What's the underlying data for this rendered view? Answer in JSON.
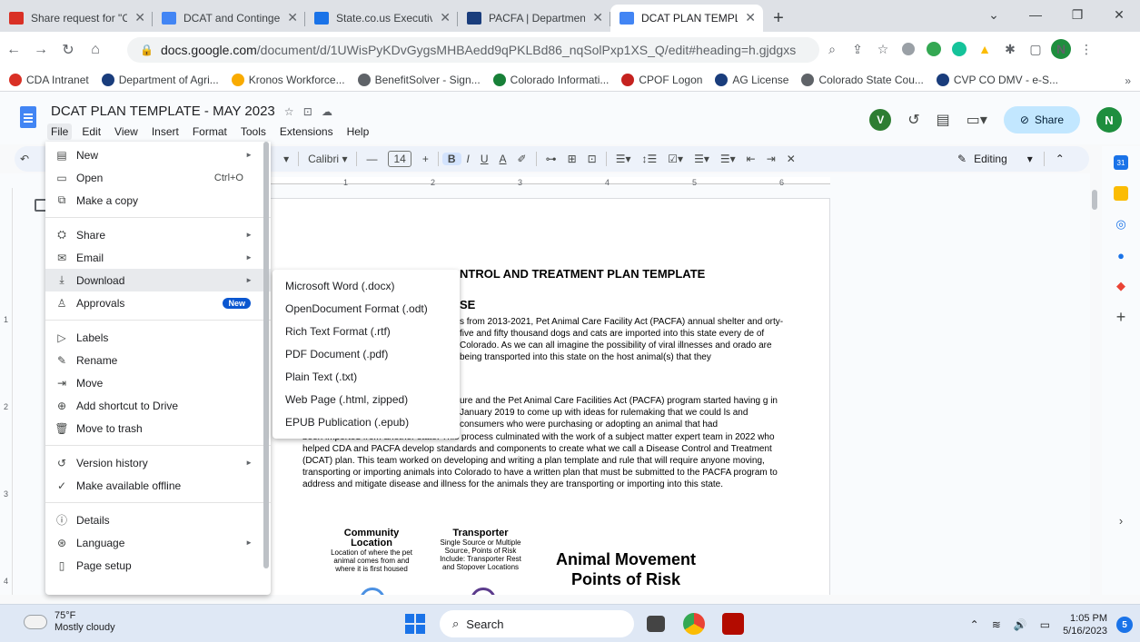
{
  "browser": {
    "tabs": [
      {
        "label": "Share request for \"CONTI",
        "fav_color": "#d93025",
        "active": false
      },
      {
        "label": "DCAT and Contingency Pl",
        "fav_color": "#4285f4",
        "active": false
      },
      {
        "label": "State.co.us Executive Bran",
        "fav_color": "#1a73e8",
        "active": false
      },
      {
        "label": "PACFA | Department of Ag",
        "fav_color": "#1a3d7c",
        "active": false
      },
      {
        "label": "DCAT PLAN TEMPLATE - M",
        "fav_color": "#4285f4",
        "active": true
      }
    ],
    "new_tab": "+",
    "url_host": "docs.google.com",
    "url_path": "/document/d/1UWisPyKDvGygsMHBAedd9qPKLBd86_nqSolPxp1XS_Q/edit#heading=h.gjdgxs",
    "profile_initial": "N",
    "bookmarks": [
      {
        "label": "CDA Intranet",
        "color": "#d93025"
      },
      {
        "label": "Department of Agri...",
        "color": "#1a3d7c"
      },
      {
        "label": "Kronos Workforce...",
        "color": "#f9ab00"
      },
      {
        "label": "BenefitSolver - Sign...",
        "color": "#5f6368"
      },
      {
        "label": "Colorado Informati...",
        "color": "#188038"
      },
      {
        "label": "CPOF Logon",
        "color": "#c5221f"
      },
      {
        "label": "AG License",
        "color": "#1a3d7c"
      },
      {
        "label": "Colorado State Cou...",
        "color": "#5f6368"
      },
      {
        "label": "CVP CO DMV - e-S...",
        "color": "#1a3d7c"
      }
    ],
    "bookmarks_more": "»"
  },
  "docs": {
    "title": "DCAT PLAN TEMPLATE - MAY 2023",
    "menus": [
      "File",
      "Edit",
      "View",
      "Insert",
      "Format",
      "Tools",
      "Extensions",
      "Help"
    ],
    "share_label": "Share",
    "avatar_initial": "N",
    "vpn_initial": "V",
    "toolbar": {
      "font": "Calibri",
      "font_size": "14",
      "editing_label": "Editing"
    }
  },
  "file_menu": {
    "items": [
      {
        "icon": "▤",
        "name": "new",
        "label": "New",
        "shortcut": "",
        "arrow": true,
        "badge": ""
      },
      {
        "icon": "▭",
        "name": "open",
        "label": "Open",
        "shortcut": "Ctrl+O",
        "arrow": false,
        "badge": ""
      },
      {
        "icon": "⧉",
        "name": "make-a-copy",
        "label": "Make a copy",
        "shortcut": "",
        "arrow": false,
        "badge": ""
      },
      {
        "sep": true
      },
      {
        "icon": "⛭",
        "name": "share",
        "label": "Share",
        "shortcut": "",
        "arrow": true,
        "badge": ""
      },
      {
        "icon": "✉",
        "name": "email",
        "label": "Email",
        "shortcut": "",
        "arrow": true,
        "badge": ""
      },
      {
        "icon": "⤓",
        "name": "download",
        "label": "Download",
        "shortcut": "",
        "arrow": true,
        "badge": "",
        "highlight": true
      },
      {
        "icon": "♙",
        "name": "approvals",
        "label": "Approvals",
        "shortcut": "",
        "arrow": false,
        "badge": "New"
      },
      {
        "sep": true
      },
      {
        "icon": "▷",
        "name": "labels",
        "label": "Labels",
        "shortcut": "",
        "arrow": false,
        "badge": ""
      },
      {
        "icon": "✎",
        "name": "rename",
        "label": "Rename",
        "shortcut": "",
        "arrow": false,
        "badge": ""
      },
      {
        "icon": "⇥",
        "name": "move",
        "label": "Move",
        "shortcut": "",
        "arrow": false,
        "badge": ""
      },
      {
        "icon": "⊕",
        "name": "add-shortcut",
        "label": "Add shortcut to Drive",
        "shortcut": "",
        "arrow": false,
        "badge": ""
      },
      {
        "icon": "🗑",
        "name": "move-to-trash",
        "label": "Move to trash",
        "shortcut": "",
        "arrow": false,
        "badge": ""
      },
      {
        "sep": true
      },
      {
        "icon": "↺",
        "name": "version-history",
        "label": "Version history",
        "shortcut": "",
        "arrow": true,
        "badge": ""
      },
      {
        "icon": "✓",
        "name": "make-available-offline",
        "label": "Make available offline",
        "shortcut": "",
        "arrow": false,
        "badge": ""
      },
      {
        "sep": true
      },
      {
        "icon": "ⓘ",
        "name": "details",
        "label": "Details",
        "shortcut": "",
        "arrow": false,
        "badge": ""
      },
      {
        "icon": "⊛",
        "name": "language",
        "label": "Language",
        "shortcut": "",
        "arrow": true,
        "badge": ""
      },
      {
        "icon": "▯",
        "name": "page-setup",
        "label": "Page setup",
        "shortcut": "",
        "arrow": false,
        "badge": ""
      }
    ]
  },
  "download_submenu": {
    "items": [
      "Microsoft Word (.docx)",
      "OpenDocument Format (.odt)",
      "Rich Text Format (.rtf)",
      "PDF Document (.pdf)",
      "Plain Text (.txt)",
      "Web Page (.html, zipped)",
      "EPUB Publication (.epub)"
    ]
  },
  "document": {
    "heading": "NTROL AND TREATMENT PLAN TEMPLATE",
    "subheading": "SE",
    "para1": "s from 2013-2021, Pet Animal Care Facility Act (PACFA) annual shelter and orty-five and fifty thousand dogs and cats are imported into this state every de of Colorado. As we can all imagine the possibility of viral illnesses and orado are being transported into this state on the host animal(s) that they",
    "para2": "ure and the Pet Animal Care Facilities Act (PACFA) program started having g in January 2019 to come up with ideas for rulemaking that we could ls and consumers who were purchasing or adopting an animal that had",
    "para3": "been imported from another state. This process culminated with the work of a subject matter expert team in 2022 who helped CDA and PACFA develop standards and components to create what we call a Disease Control and Treatment (DCAT) plan. This team worked on developing and writing a plan template and rule that will require anyone moving, transporting or importing animals into Colorado to have a written plan that must be submitted to the PACFA program to address and mitigate disease and illness for the animals they are transporting or importing into this state.",
    "infographic": {
      "col1_title": "Community Location",
      "col1_body": "Location of where the pet animal comes from and where it is first housed",
      "col2_title": "Transporter",
      "col2_body": "Single Source or Multiple Source, Points of Risk Include: Transporter Rest and Stopover Locations",
      "big_title": "Animal Movement Points of Risk"
    }
  },
  "taskbar": {
    "temp": "75°F",
    "weather": "Mostly cloudy",
    "search": "Search",
    "time": "1:05 PM",
    "date": "5/16/2023",
    "notifications": "5"
  }
}
